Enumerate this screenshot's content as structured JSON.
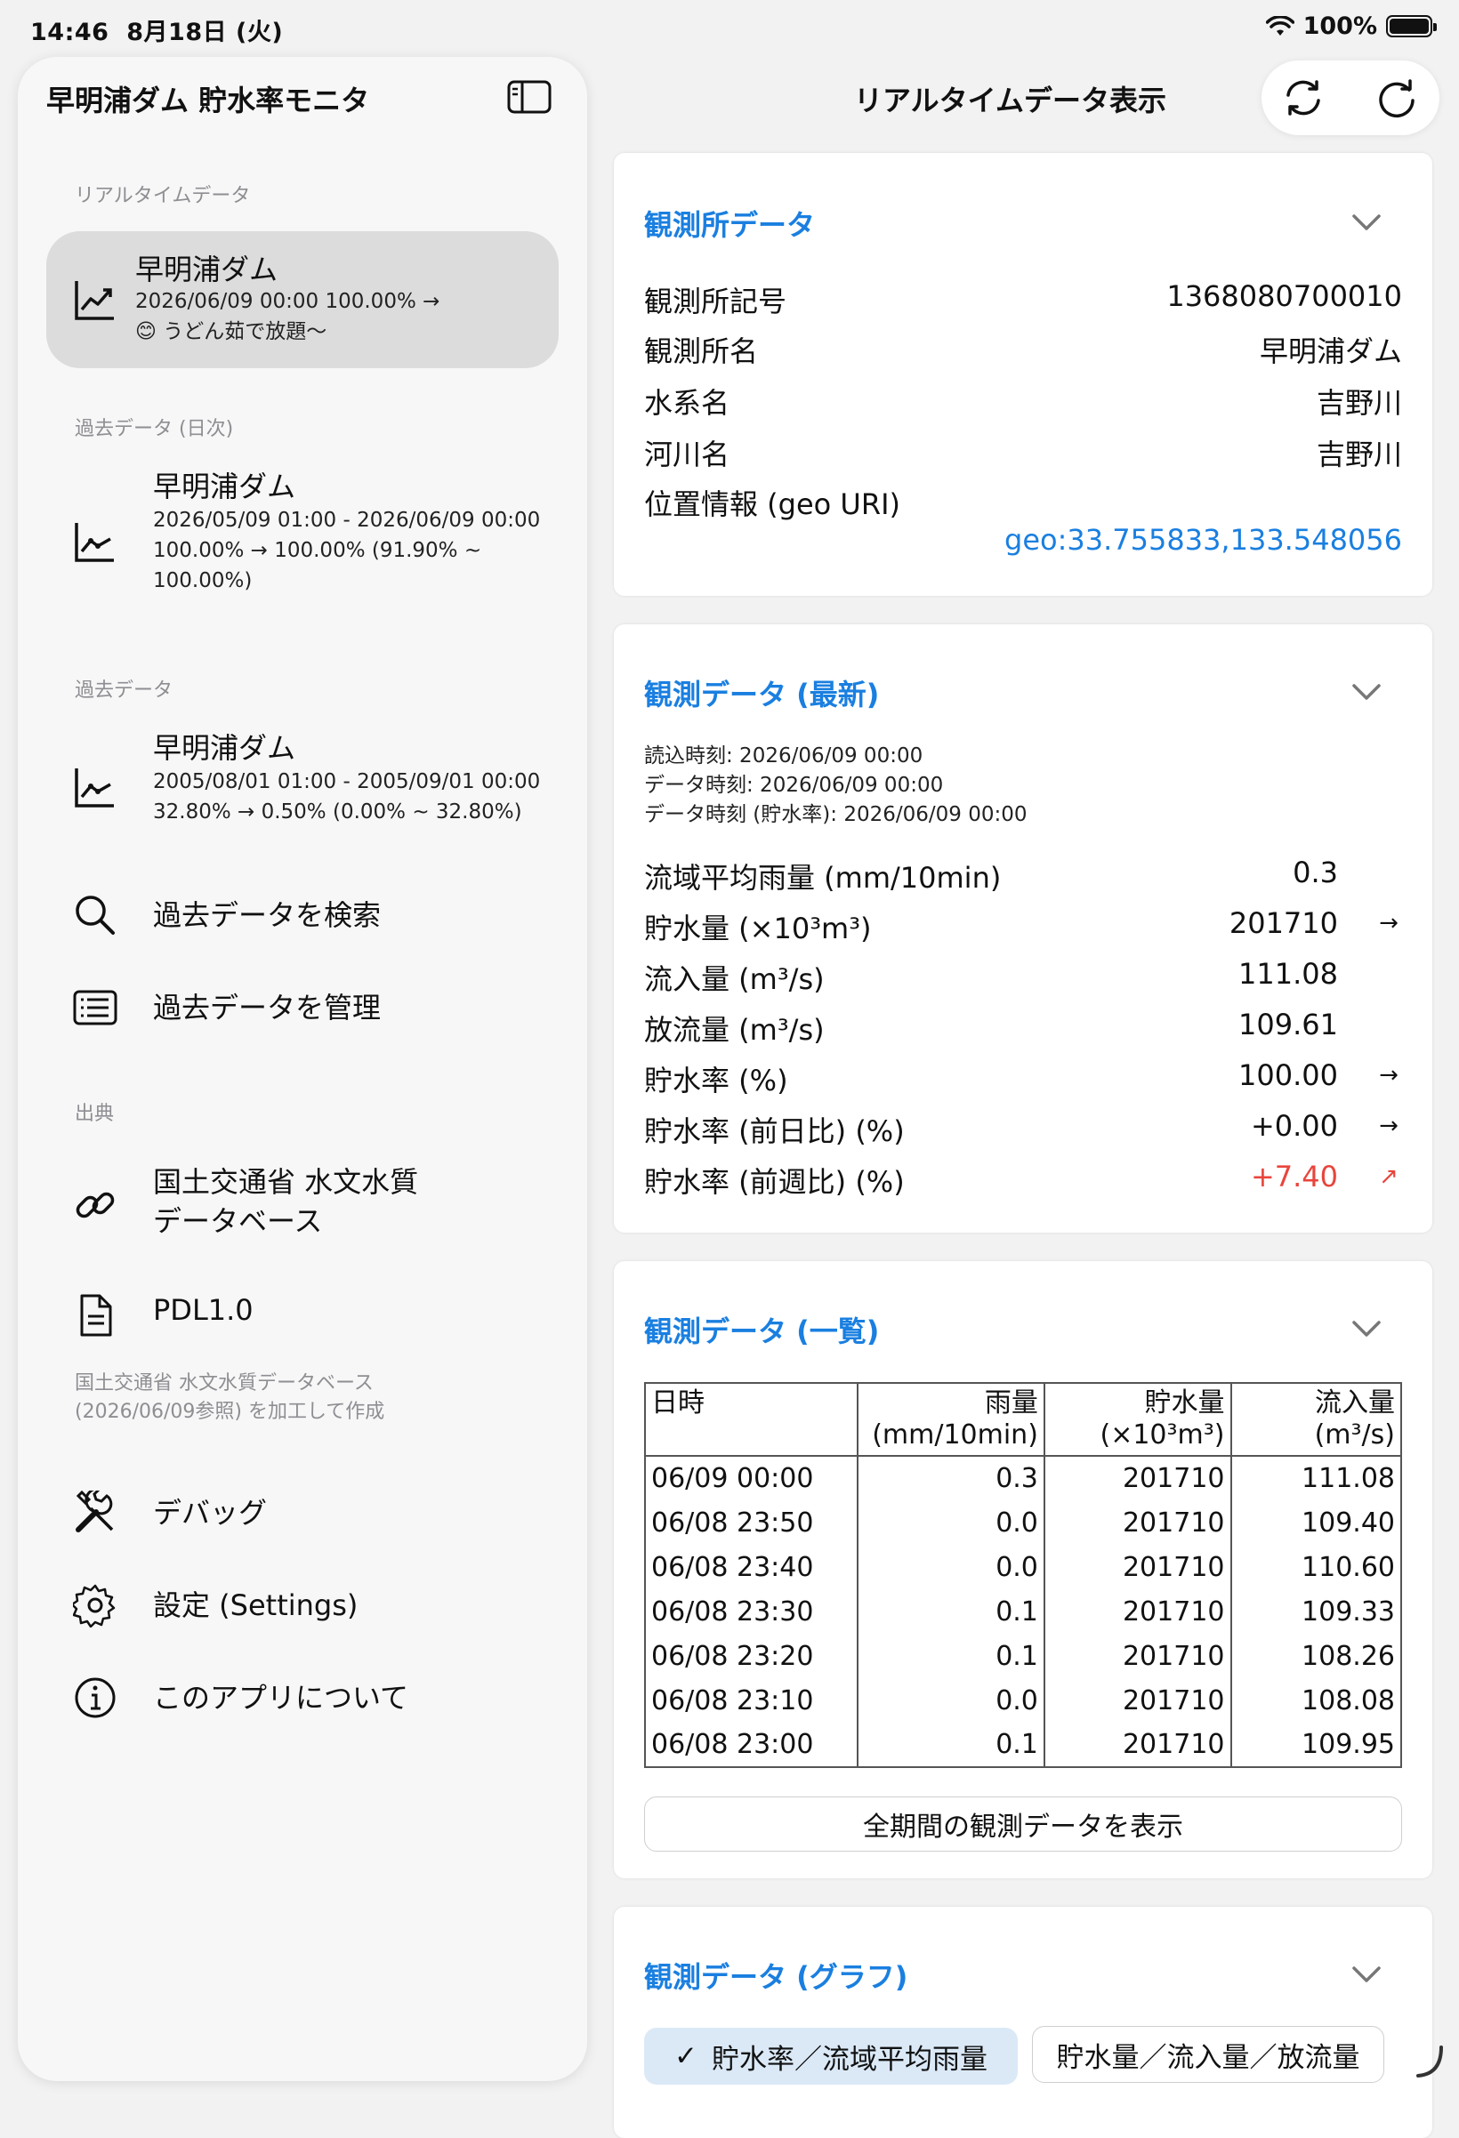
{
  "status": {
    "time": "14:46",
    "date": "8月18日 (火)",
    "battery": "100%"
  },
  "sidebar": {
    "title": "早明浦ダム 貯水率モニタ",
    "toggle_icon": "sidebar-toggle-icon",
    "realtime_section": "リアルタイムデータ",
    "realtime_item": {
      "title": "早明浦ダム",
      "line1": "2026/06/09 00:00 100.00% →",
      "emoji": "😊",
      "line2": "うどん茹で放題〜"
    },
    "daily_section": "過去データ (日次)",
    "daily_item": {
      "title": "早明浦ダム",
      "line1": "2026/05/09 01:00 - 2026/06/09 00:00",
      "line2": "100.00% → 100.00% (91.90% ~",
      "line3": "100.00%)"
    },
    "past_section": "過去データ",
    "past_item": {
      "title": "早明浦ダム",
      "line1": "2005/08/01 01:00 - 2005/09/01 00:00",
      "line2": "32.80% → 0.50% (0.00% ~ 32.80%)"
    },
    "search_label": "過去データを検索",
    "manage_label": "過去データを管理",
    "source_section": "出典",
    "source_link1": "国土交通省 水文水質",
    "source_link2": "データベース",
    "pdl_label": "PDL1.0",
    "attribution1": "国土交通省 水文水質データベース",
    "attribution2": "(2026/06/09参照) を加工して作成",
    "debug_label": "デバッグ",
    "settings_label": "設定 (Settings)",
    "about_label": "このアプリについて"
  },
  "main": {
    "title": "リアルタイムデータ表示",
    "station": {
      "header": "観測所データ",
      "rows": [
        {
          "k": "観測所記号",
          "v": "1368080700010"
        },
        {
          "k": "観測所名",
          "v": "早明浦ダム"
        },
        {
          "k": "水系名",
          "v": "吉野川"
        },
        {
          "k": "河川名",
          "v": "吉野川"
        }
      ],
      "geo_label": "位置情報 (geo URI)",
      "geo_value": "geo:33.755833,133.548056"
    },
    "latest": {
      "header": "観測データ (最新)",
      "read_time": "読込時刻: 2026/06/09 00:00",
      "data_time": "データ時刻: 2026/06/09 00:00",
      "data_time_rate": "データ時刻 (貯水率): 2026/06/09 00:00",
      "rows": [
        {
          "k": "流域平均雨量 (mm/10min)",
          "v": "0.3",
          "a": ""
        },
        {
          "k": "貯水量 (×10³m³)",
          "v": "201710",
          "a": "→"
        },
        {
          "k": "流入量 (m³/s)",
          "v": "111.08",
          "a": ""
        },
        {
          "k": "放流量 (m³/s)",
          "v": "109.61",
          "a": ""
        },
        {
          "k": "貯水率 (%)",
          "v": "100.00",
          "a": "→"
        },
        {
          "k": "貯水率 (前日比) (%)",
          "v": "+0.00",
          "a": "→"
        },
        {
          "k": "貯水率 (前週比) (%)",
          "v": "+7.40",
          "a": "↗"
        }
      ],
      "up_color": "#e8453c"
    },
    "list": {
      "header": "観測データ (一覧)",
      "columns": [
        {
          "l1": "日時",
          "l2": ""
        },
        {
          "l1": "雨量",
          "l2": "(mm/10min)"
        },
        {
          "l1": "貯水量",
          "l2": "(×10³m³)"
        },
        {
          "l1": "流入量",
          "l2": "(m³/s)"
        }
      ],
      "rows": [
        [
          "06/09 00:00",
          "0.3",
          "201710",
          "111.08"
        ],
        [
          "06/08 23:50",
          "0.0",
          "201710",
          "109.40"
        ],
        [
          "06/08 23:40",
          "0.0",
          "201710",
          "110.60"
        ],
        [
          "06/08 23:30",
          "0.1",
          "201710",
          "109.33"
        ],
        [
          "06/08 23:20",
          "0.1",
          "201710",
          "108.26"
        ],
        [
          "06/08 23:10",
          "0.0",
          "201710",
          "108.08"
        ],
        [
          "06/08 23:00",
          "0.1",
          "201710",
          "109.95"
        ]
      ],
      "full_button": "全期間の観測データを表示"
    },
    "graph": {
      "header": "観測データ (グラフ)",
      "seg_active": "貯水率／流域平均雨量",
      "seg_inactive": "貯水量／流入量／放流量",
      "check": "✓"
    }
  },
  "accent": "#1a7fe0"
}
